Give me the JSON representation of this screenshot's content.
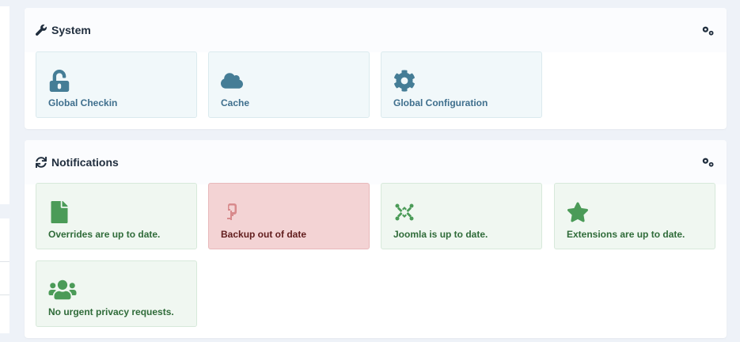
{
  "system": {
    "title": "System",
    "tiles": [
      {
        "label": "Global Checkin",
        "icon": "unlock-icon"
      },
      {
        "label": "Cache",
        "icon": "cloud-icon"
      },
      {
        "label": "Global Configuration",
        "icon": "cog-icon"
      }
    ]
  },
  "notifications": {
    "title": "Notifications",
    "tiles": [
      {
        "label": "Overrides are up to date.",
        "icon": "file-icon",
        "status": "success"
      },
      {
        "label": "Backup out of date",
        "icon": "backup-icon",
        "status": "danger"
      },
      {
        "label": "Joomla is up to date.",
        "icon": "joomla-icon",
        "status": "success"
      },
      {
        "label": "Extensions are up to date.",
        "icon": "star-icon",
        "status": "success"
      },
      {
        "label": "No urgent privacy requests.",
        "icon": "users-icon",
        "status": "success"
      }
    ]
  },
  "colors": {
    "info_bg": "#f1f8fa",
    "success_bg": "#f0f7f1",
    "danger_bg": "#f3d3d4",
    "info_text": "#3f6f8d",
    "success_text": "#2f6b39",
    "danger_text": "#611d1d"
  }
}
